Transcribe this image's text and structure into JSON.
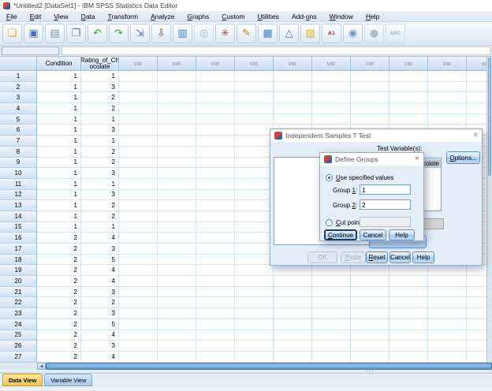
{
  "window": {
    "title": "*Untitled2 [DataSet1] - IBM SPSS Statistics Data Editor"
  },
  "icons": {
    "close": "×",
    "scroll_left": "◀",
    "splitter_dots": "···"
  },
  "menu": {
    "items": [
      {
        "label": "File",
        "u": 0
      },
      {
        "label": "Edit",
        "u": 0
      },
      {
        "label": "View",
        "u": 0
      },
      {
        "label": "Data",
        "u": 0
      },
      {
        "label": "Transform",
        "u": 0
      },
      {
        "label": "Analyze",
        "u": 0
      },
      {
        "label": "Graphs",
        "u": 0
      },
      {
        "label": "Custom",
        "u": 0
      },
      {
        "label": "Utilities",
        "u": 0
      },
      {
        "label": "Add-ons",
        "u": 4
      },
      {
        "label": "Window",
        "u": 0
      },
      {
        "label": "Help",
        "u": 0
      }
    ]
  },
  "toolbar": {
    "icons": [
      {
        "name": "open-data-document-icon",
        "glyph": "❏",
        "color": "#e8a33d"
      },
      {
        "name": "save-document-icon",
        "glyph": "▣",
        "color": "#4a6fb5"
      },
      {
        "name": "print-icon",
        "glyph": "▤",
        "color": "#8494a4"
      },
      {
        "name": "recall-dialogs-icon",
        "glyph": "❐",
        "color": "#4a7cc0"
      },
      {
        "name": "undo-icon",
        "glyph": "↶",
        "color": "#3fa045"
      },
      {
        "name": "redo-icon",
        "glyph": "↷",
        "color": "#3fa045"
      },
      {
        "name": "go-to-case-icon",
        "glyph": "⇲",
        "color": "#4a7cc0"
      },
      {
        "name": "go-to-variable-icon",
        "glyph": "⇩",
        "color": "#c03a30"
      },
      {
        "name": "variables-icon",
        "glyph": "▥",
        "color": "#4a7cc0"
      },
      {
        "name": "find-icon",
        "glyph": "◎",
        "color": "#7a8a98",
        "disabled": true
      },
      {
        "name": "insert-cases-icon",
        "glyph": "✳",
        "color": "#c03a30"
      },
      {
        "name": "insert-variable-icon",
        "glyph": "✎",
        "color": "#c08a2a"
      },
      {
        "name": "split-file-icon",
        "glyph": "▦",
        "color": "#4a7cc0"
      },
      {
        "name": "weight-cases-icon",
        "glyph": "△",
        "color": "#4a7cc0"
      },
      {
        "name": "select-cases-icon",
        "glyph": "▧",
        "color": "#d8b030"
      },
      {
        "name": "value-labels-icon",
        "glyph": "A1",
        "color": "#c03a30",
        "text": true
      },
      {
        "name": "use-variable-sets-icon",
        "glyph": "◉",
        "color": "#6a96c8"
      },
      {
        "name": "show-all-variables-icon",
        "glyph": "●",
        "color": "#8a9298",
        "disabled": true
      },
      {
        "name": "spell-check-icon",
        "glyph": "ABC",
        "color": "#7a8a98",
        "disabled": true,
        "text": true
      }
    ]
  },
  "cell_reference": {
    "value": ""
  },
  "grid": {
    "columns": [
      "",
      "Condition",
      "Rating_of_Ch\nocolate"
    ],
    "var_label": "var",
    "var_count": 10,
    "rows": [
      [
        1,
        1,
        1
      ],
      [
        2,
        1,
        3
      ],
      [
        3,
        1,
        2
      ],
      [
        4,
        1,
        2
      ],
      [
        5,
        1,
        1
      ],
      [
        6,
        1,
        3
      ],
      [
        7,
        1,
        1
      ],
      [
        8,
        1,
        2
      ],
      [
        9,
        1,
        2
      ],
      [
        10,
        1,
        3
      ],
      [
        11,
        1,
        1
      ],
      [
        12,
        1,
        3
      ],
      [
        13,
        1,
        2
      ],
      [
        14,
        1,
        2
      ],
      [
        15,
        1,
        1
      ],
      [
        16,
        2,
        4
      ],
      [
        17,
        2,
        3
      ],
      [
        18,
        2,
        5
      ],
      [
        19,
        2,
        4
      ],
      [
        20,
        2,
        4
      ],
      [
        21,
        2,
        3
      ],
      [
        22,
        2,
        2
      ],
      [
        23,
        2,
        3
      ],
      [
        24,
        2,
        5
      ],
      [
        25,
        2,
        4
      ],
      [
        26,
        2,
        3
      ],
      [
        27,
        2,
        4
      ]
    ]
  },
  "tabs": {
    "data_view": "Data View",
    "variable_view": "Variable View"
  },
  "ttest_dialog": {
    "title": "Independent-Samples T Test",
    "test_variables_label": "Test Variable(s):",
    "test_variable_item": "Rating_of_Chocolate",
    "options_button": {
      "label": "Options...",
      "u": 0
    },
    "ok_button": "OK",
    "paste_button": {
      "label": "Paste",
      "u": 0
    },
    "reset_button": {
      "label": "Reset",
      "u": 0
    },
    "cancel_button": "Cancel",
    "help_button": "Help"
  },
  "define_groups_dialog": {
    "title": "Define Groups",
    "use_specified_radio": {
      "label": "Use specified values",
      "u": 0
    },
    "group1_label": {
      "label": "Group 1:",
      "u": 6
    },
    "group1_value": "1",
    "group2_label": {
      "label": "Group 2:",
      "u": 6
    },
    "group2_value": "2",
    "cut_point_radio": {
      "label": "Cut point:",
      "u": 0
    },
    "cut_point_value": "",
    "continue_button": {
      "label": "Continue",
      "u": 0
    },
    "cancel_button": "Cancel",
    "help_button": "Help"
  }
}
